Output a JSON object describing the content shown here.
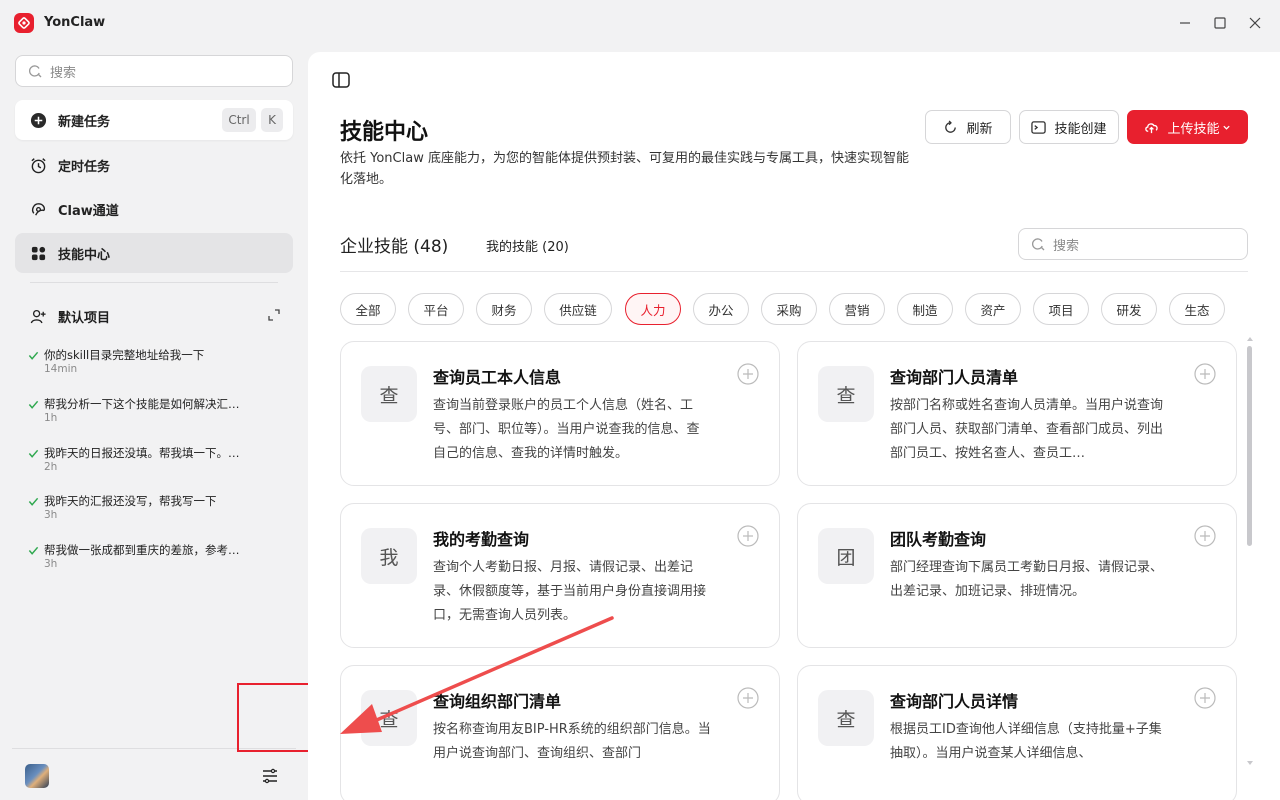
{
  "app": {
    "title": "YonClaw"
  },
  "sidebar": {
    "search_placeholder": "搜索",
    "new_task": {
      "label": "新建任务",
      "shortcut": [
        "Ctrl",
        "K"
      ]
    },
    "nav": [
      {
        "label": "定时任务",
        "icon": "alarm-clock-icon"
      },
      {
        "label": "Claw通道",
        "icon": "claw-channel-icon"
      },
      {
        "label": "技能中心",
        "icon": "grid-icon",
        "active": true
      }
    ],
    "project": {
      "label": "默认项目"
    },
    "history": [
      {
        "title": "你的skill目录完整地址给我一下",
        "time": "14min"
      },
      {
        "title": "帮我分析一下这个技能是如何解决汇…",
        "time": "1h"
      },
      {
        "title": "我昨天的日报还没填。帮我填一下。…",
        "time": "2h"
      },
      {
        "title": "我昨天的汇报还没写，帮我写一下",
        "time": "3h"
      },
      {
        "title": "帮我做一张成都到重庆的差旅，参考…",
        "time": "3h"
      }
    ]
  },
  "main": {
    "title": "技能中心",
    "description": "依托 YonClaw 底座能力，为您的智能体提供预封装、可复用的最佳实践与专属工具，快速实现智能化落地。",
    "buttons": {
      "refresh": "刷新",
      "create": "技能创建",
      "upload": "上传技能"
    },
    "tabs": {
      "enterprise": "企业技能 (48)",
      "mine": "我的技能 (20)"
    },
    "search_placeholder": "搜索",
    "categories": [
      "全部",
      "平台",
      "财务",
      "供应链",
      "人力",
      "办公",
      "采购",
      "营销",
      "制造",
      "资产",
      "项目",
      "研发",
      "生态"
    ],
    "active_category": "人力",
    "cards": [
      {
        "badge": "查",
        "title": "查询员工本人信息",
        "desc": "查询当前登录账户的员工个人信息（姓名、工号、部门、职位等）。当用户说查我的信息、查自己的信息、查我的详情时触发。"
      },
      {
        "badge": "查",
        "title": "查询部门人员清单",
        "desc": "按部门名称或姓名查询人员清单。当用户说查询部门人员、获取部门清单、查看部门成员、列出部门员工、按姓名查人、查员工…"
      },
      {
        "badge": "我",
        "title": "我的考勤查询",
        "desc": "查询个人考勤日报、月报、请假记录、出差记录、休假额度等，基于当前用户身份直接调用接口，无需查询人员列表。"
      },
      {
        "badge": "团",
        "title": "团队考勤查询",
        "desc": "部门经理查询下属员工考勤日月报、请假记录、出差记录、加班记录、排班情况。"
      },
      {
        "badge": "查",
        "title": "查询组织部门清单",
        "desc": "按名称查询用友BIP-HR系统的组织部门信息。当用户说查询部门、查询组织、查部门"
      },
      {
        "badge": "查",
        "title": "查询部门人员详情",
        "desc": "根据员工ID查询他人详细信息（支持批量+子集抽取）。当用户说查某人详细信息、"
      }
    ]
  },
  "colors": {
    "accent": "#e8202e",
    "success": "#2fa84f"
  }
}
